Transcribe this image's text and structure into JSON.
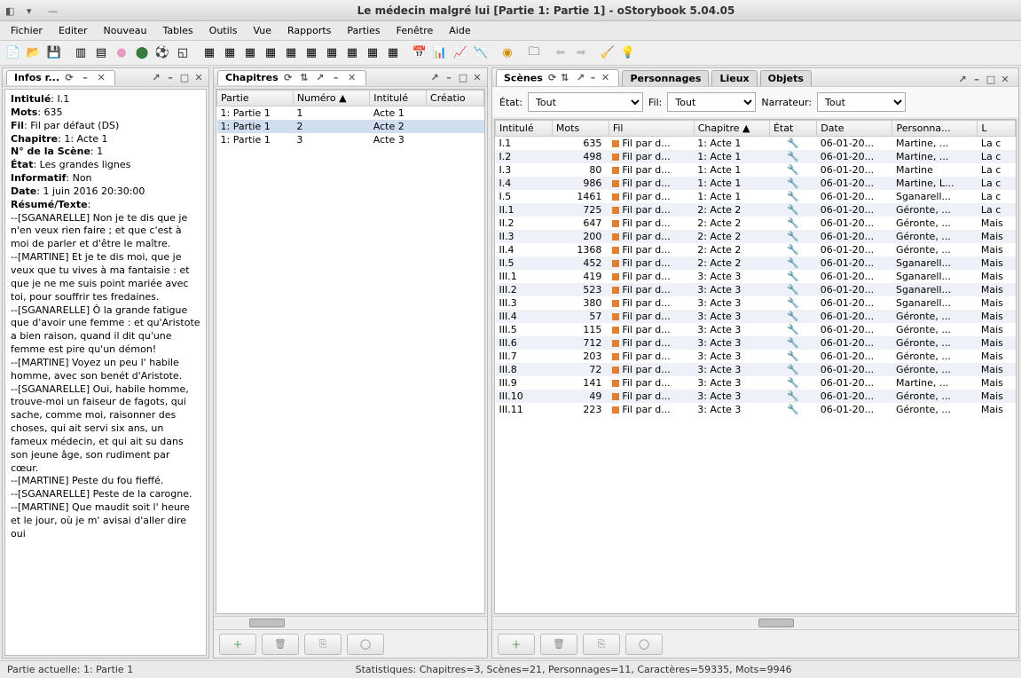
{
  "window": {
    "title": "Le médecin malgré lui [Partie 1: Partie 1] - oStorybook 5.04.05"
  },
  "menu": [
    "Fichier",
    "Editer",
    "Nouveau",
    "Tables",
    "Outils",
    "Vue",
    "Rapports",
    "Parties",
    "Fenêtre",
    "Aide"
  ],
  "infosPanel": {
    "title": "Infos r...",
    "fields": {
      "intitule_label": "Intitulé",
      "intitule": "I.1",
      "mots_label": "Mots",
      "mots": "635",
      "fil_label": "Fil",
      "fil": "Fil par défaut (DS)",
      "chapitre_label": "Chapitre",
      "chapitre": "1: Acte 1",
      "numscene_label": "N° de la Scène",
      "numscene": "1",
      "etat_label": "État",
      "etat": "Les grandes lignes",
      "informatif_label": "Informatif",
      "informatif": "Non",
      "date_label": "Date",
      "date": "1 juin 2016 20:30:00",
      "resume_label": "Résumé/Texte"
    },
    "resume": "--[SGANARELLE] Non je te dis que je n'en veux rien faire ; et que c'est à moi de parler et d'être le maître.\n--[MARTINE] Et je te dis moi, que je veux que tu vives à ma fantaisie : et que je ne me suis point mariée avec toi, pour souffrir tes fredaines.\n--[SGANARELLE] Ô la grande fatigue que d'avoir une femme : et qu'Aristote a bien raison, quand il dit qu'une femme est pire qu'un démon!\n--[MARTINE] Voyez un peu l' habile homme, avec son benét d'Aristote.\n--[SGANARELLE] Oui, habile homme, trouve-moi un faiseur de fagots, qui sache, comme moi, raisonner des choses, qui ait servi six ans, un fameux médecin, et qui ait su dans son jeune âge, son rudiment par cœur.\n--[MARTINE] Peste du fou fieffé.\n--[SGANARELLE] Peste de la carogne.\n--[MARTINE] Que maudit soit l' heure et le jour, où je m' avisai d'aller dire oui"
  },
  "chapitresPanel": {
    "title": "Chapitres",
    "headers": [
      "Partie",
      "Numéro ▲",
      "Intitulé",
      "Créatio"
    ],
    "rows": [
      {
        "partie": "1: Partie 1",
        "numero": "1",
        "intitule": "Acte 1"
      },
      {
        "partie": "1: Partie 1",
        "numero": "2",
        "intitule": "Acte 2"
      },
      {
        "partie": "1: Partie 1",
        "numero": "3",
        "intitule": "Acte 3"
      }
    ]
  },
  "scenesPanel": {
    "tabs": [
      "Scènes",
      "Personnages",
      "Lieux",
      "Objets"
    ],
    "filters": {
      "etat_label": "État:",
      "etat_value": "Tout",
      "fil_label": "Fil:",
      "fil_value": "Tout",
      "narrateur_label": "Narrateur:",
      "narrateur_value": "Tout"
    },
    "headers": [
      "Intitulé",
      "Mots",
      "Fil",
      "Chapitre ▲",
      "État",
      "Date",
      "Personna...",
      "L"
    ],
    "rows": [
      {
        "intitule": "I.1",
        "mots": "635",
        "fil": "Fil par d...",
        "chap": "1: Acte 1",
        "date": "06-01-20...",
        "pers": "Martine, ...",
        "lieu": "La c"
      },
      {
        "intitule": "I.2",
        "mots": "498",
        "fil": "Fil par d...",
        "chap": "1: Acte 1",
        "date": "06-01-20...",
        "pers": "Martine, ...",
        "lieu": "La c"
      },
      {
        "intitule": "I.3",
        "mots": "80",
        "fil": "Fil par d...",
        "chap": "1: Acte 1",
        "date": "06-01-20...",
        "pers": "Martine",
        "lieu": "La c"
      },
      {
        "intitule": "I.4",
        "mots": "986",
        "fil": "Fil par d...",
        "chap": "1: Acte 1",
        "date": "06-01-20...",
        "pers": "Martine, L...",
        "lieu": "La c"
      },
      {
        "intitule": "I.5",
        "mots": "1461",
        "fil": "Fil par d...",
        "chap": "1: Acte 1",
        "date": "06-01-20...",
        "pers": "Sganarell...",
        "lieu": "La c"
      },
      {
        "intitule": "II.1",
        "mots": "725",
        "fil": "Fil par d...",
        "chap": "2: Acte 2",
        "date": "06-01-20...",
        "pers": "Géronte, ...",
        "lieu": "La c"
      },
      {
        "intitule": "II.2",
        "mots": "647",
        "fil": "Fil par d...",
        "chap": "2: Acte 2",
        "date": "06-01-20...",
        "pers": "Géronte, ...",
        "lieu": "Mais"
      },
      {
        "intitule": "II.3",
        "mots": "200",
        "fil": "Fil par d...",
        "chap": "2: Acte 2",
        "date": "06-01-20...",
        "pers": "Géronte, ...",
        "lieu": "Mais"
      },
      {
        "intitule": "II.4",
        "mots": "1368",
        "fil": "Fil par d...",
        "chap": "2: Acte 2",
        "date": "06-01-20...",
        "pers": "Géronte, ...",
        "lieu": "Mais"
      },
      {
        "intitule": "II.5",
        "mots": "452",
        "fil": "Fil par d...",
        "chap": "2: Acte 2",
        "date": "06-01-20...",
        "pers": "Sganarell...",
        "lieu": "Mais"
      },
      {
        "intitule": "III.1",
        "mots": "419",
        "fil": "Fil par d...",
        "chap": "3: Acte 3",
        "date": "06-01-20...",
        "pers": "Sganarell...",
        "lieu": "Mais"
      },
      {
        "intitule": "III.2",
        "mots": "523",
        "fil": "Fil par d...",
        "chap": "3: Acte 3",
        "date": "06-01-20...",
        "pers": "Sganarell...",
        "lieu": "Mais"
      },
      {
        "intitule": "III.3",
        "mots": "380",
        "fil": "Fil par d...",
        "chap": "3: Acte 3",
        "date": "06-01-20...",
        "pers": "Sganarell...",
        "lieu": "Mais"
      },
      {
        "intitule": "III.4",
        "mots": "57",
        "fil": "Fil par d...",
        "chap": "3: Acte 3",
        "date": "06-01-20...",
        "pers": "Géronte, ...",
        "lieu": "Mais"
      },
      {
        "intitule": "III.5",
        "mots": "115",
        "fil": "Fil par d...",
        "chap": "3: Acte 3",
        "date": "06-01-20...",
        "pers": "Géronte, ...",
        "lieu": "Mais"
      },
      {
        "intitule": "III.6",
        "mots": "712",
        "fil": "Fil par d...",
        "chap": "3: Acte 3",
        "date": "06-01-20...",
        "pers": "Géronte, ...",
        "lieu": "Mais"
      },
      {
        "intitule": "III.7",
        "mots": "203",
        "fil": "Fil par d...",
        "chap": "3: Acte 3",
        "date": "06-01-20...",
        "pers": "Géronte, ...",
        "lieu": "Mais"
      },
      {
        "intitule": "III.8",
        "mots": "72",
        "fil": "Fil par d...",
        "chap": "3: Acte 3",
        "date": "06-01-20...",
        "pers": "Géronte, ...",
        "lieu": "Mais"
      },
      {
        "intitule": "III.9",
        "mots": "141",
        "fil": "Fil par d...",
        "chap": "3: Acte 3",
        "date": "06-01-20...",
        "pers": "Martine, ...",
        "lieu": "Mais"
      },
      {
        "intitule": "III.10",
        "mots": "49",
        "fil": "Fil par d...",
        "chap": "3: Acte 3",
        "date": "06-01-20...",
        "pers": "Géronte, ...",
        "lieu": "Mais"
      },
      {
        "intitule": "III.11",
        "mots": "223",
        "fil": "Fil par d...",
        "chap": "3: Acte 3",
        "date": "06-01-20...",
        "pers": "Géronte, ...",
        "lieu": "Mais"
      }
    ]
  },
  "status": {
    "left": "Partie actuelle: 1: Partie 1",
    "center": "Statistiques: Chapitres=3,  Scènes=21,  Personnages=11,  Caractères=59335,  Mots=9946"
  }
}
